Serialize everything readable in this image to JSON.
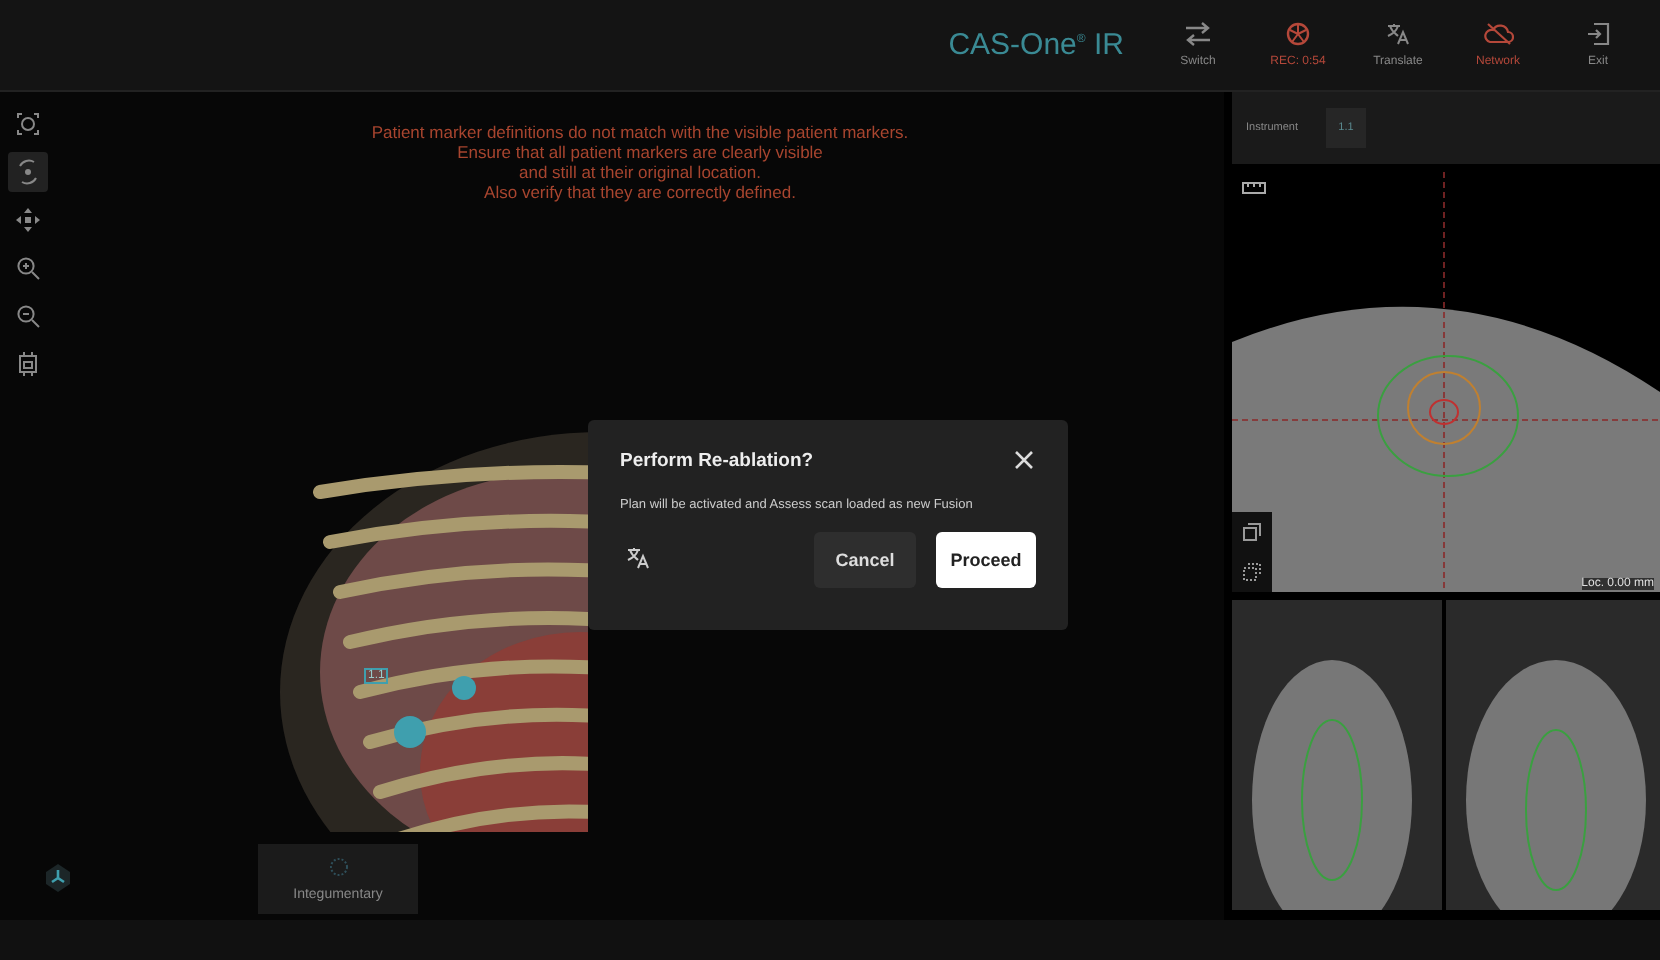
{
  "app_title": {
    "name": "CAS-One",
    "mark": "®",
    "suffix": "IR"
  },
  "top_actions": [
    {
      "label": "Switch",
      "alert": false
    },
    {
      "label": "REC: 0:54",
      "alert": true
    },
    {
      "label": "Translate",
      "alert": false
    },
    {
      "label": "Network",
      "alert": true
    },
    {
      "label": "Exit",
      "alert": false
    }
  ],
  "tools": [
    {
      "selected": false
    },
    {
      "selected": true
    },
    {
      "selected": false
    },
    {
      "selected": false
    },
    {
      "selected": false
    },
    {
      "selected": false
    }
  ],
  "warning": [
    "Patient marker definitions do not match with the visible patient markers.",
    "Ensure that all patient markers are clearly visible",
    "and still at their original location.",
    "Also verify that they are correctly defined."
  ],
  "marker_label": "1.1",
  "layer_card": {
    "label": "Integumentary"
  },
  "instrument": {
    "label": "Instrument",
    "value": "1.1"
  },
  "ct_view": {
    "location": "Loc. 0.00 mm"
  },
  "dialog": {
    "title": "Perform Re-ablation?",
    "message": "Plan will be activated and Assess scan loaded as new Fusion",
    "buttons": [
      {
        "label": "Cancel",
        "kind": "secondary"
      },
      {
        "label": "Proceed",
        "kind": "primary"
      }
    ]
  }
}
